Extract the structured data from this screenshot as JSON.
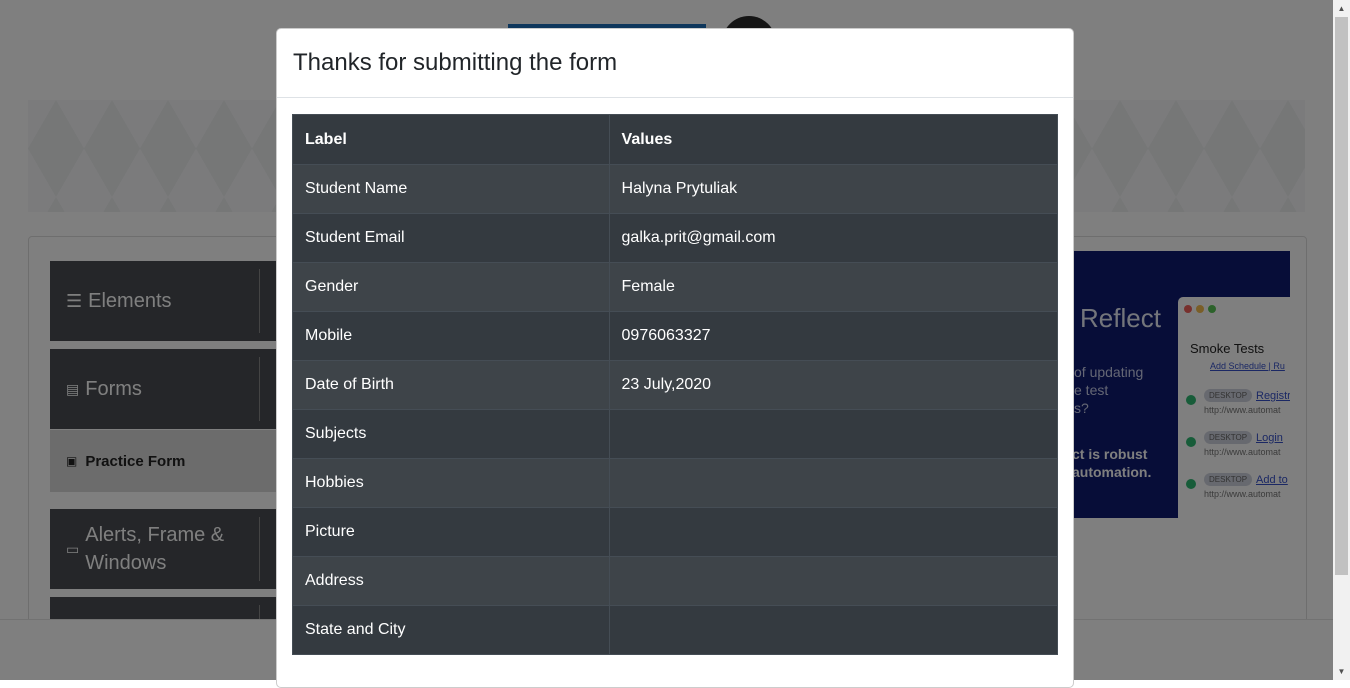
{
  "sidebar": {
    "elements_label": "Elements",
    "forms_label": "Forms",
    "practice_form_label": "Practice Form",
    "alerts_label": "Alerts, Frame & Windows"
  },
  "ad": {
    "title": "Reflect",
    "line1": "of updating\ne test\ns?",
    "line2": "ct is robust\nautomation.",
    "window_title": "Smoke Tests",
    "window_links": "Add Schedule | Ru",
    "rows": [
      {
        "tag": "DESKTOP",
        "link": "Registr",
        "url": "http://www.automat"
      },
      {
        "tag": "DESKTOP",
        "link": "Login",
        "url": "http://www.automat"
      },
      {
        "tag": "DESKTOP",
        "link": "Add to",
        "url": "http://www.automat"
      }
    ]
  },
  "modal": {
    "title": "Thanks for submitting the form",
    "table": {
      "headers": [
        "Label",
        "Values"
      ],
      "rows": [
        {
          "label": "Student Name",
          "value": "Halyna Prytuliak"
        },
        {
          "label": "Student Email",
          "value": "galka.prit@gmail.com"
        },
        {
          "label": "Gender",
          "value": "Female"
        },
        {
          "label": "Mobile",
          "value": "0976063327"
        },
        {
          "label": "Date of Birth",
          "value": "23 July,2020"
        },
        {
          "label": "Subjects",
          "value": ""
        },
        {
          "label": "Hobbies",
          "value": ""
        },
        {
          "label": "Picture",
          "value": ""
        },
        {
          "label": "Address",
          "value": ""
        },
        {
          "label": "State and City",
          "value": ""
        }
      ]
    }
  },
  "colors": {
    "table_bg": "#343a40",
    "backdrop": "rgba(0,0,0,0.5)",
    "sidebar_bg": "#4a4d52",
    "ad_bg": "#0f1b70"
  }
}
